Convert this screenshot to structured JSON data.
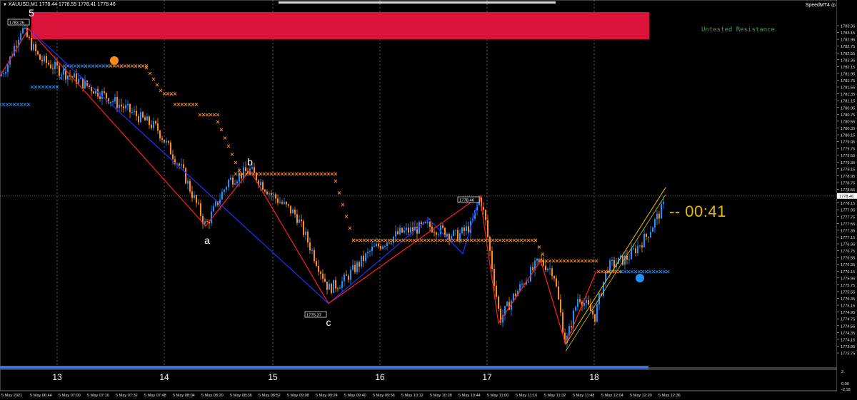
{
  "window": {
    "symbol_info": "XAUUSD,M1  1778.44 1778.55 1778.41 1778.46",
    "speed_badge": "SpeedMT4"
  },
  "labels": {
    "zone_text": "Untested Resistance",
    "countdown": "-- 00:41",
    "wave_5": "5",
    "wave_a": "a",
    "wave_b": "b",
    "wave_c": "c",
    "price_box_high": "1783.26",
    "price_box_mid": "1778.46",
    "price_box_low": "1775.37",
    "current_price_tag": "1778.46"
  },
  "colors": {
    "background": "#000000",
    "bull_candle": "#1e90ff",
    "bear_candle": "#ff8c1a",
    "resistance_zone": "#dc143c",
    "orange_marker": "#ff8c1a",
    "blue_marker": "#1e90ff",
    "zigzag": "#ff2020",
    "wave_line": "#2030ff",
    "channel": "#e6c200",
    "zone_text": "#2aa84a",
    "countdown": "#e6b800"
  },
  "axes": {
    "price_ticks": [
      "1783.35",
      "1783.15",
      "1782.95",
      "1782.75",
      "1782.55",
      "1782.35",
      "1782.15",
      "1781.95",
      "1781.75",
      "1781.55",
      "1781.35",
      "1781.15",
      "1780.95",
      "1780.75",
      "1780.55",
      "1780.35",
      "1780.15",
      "1779.95",
      "1779.75",
      "1779.55",
      "1779.35",
      "1779.15",
      "1778.95",
      "1778.75",
      "1778.55",
      "1778.35",
      "1778.15",
      "1777.95",
      "1777.75",
      "1777.55",
      "1777.35",
      "1777.15",
      "1776.95",
      "1776.75",
      "1776.55",
      "1776.35",
      "1776.15",
      "1775.95",
      "1775.75",
      "1775.55",
      "1775.35",
      "1775.15",
      "1774.95",
      "1774.75",
      "1774.55",
      "1774.35",
      "1774.15",
      "1773.95",
      "1773.75"
    ],
    "sub_ticks": [
      "2",
      "0,00",
      "-2,18"
    ],
    "time_ticks": [
      "5 May 2021",
      "5 May 06:44",
      "5 May 07:00",
      "5 May 07:16",
      "5 May 07:32",
      "5 May 07:48",
      "5 May 08:04",
      "5 May 08:20",
      "5 May 08:36",
      "5 May 08:52",
      "5 May 09:08",
      "5 May 09:24",
      "5 May 09:40",
      "5 May 09:56",
      "5 May 10:12",
      "5 May 10:28",
      "5 May 10:44",
      "5 May 11:00",
      "5 May 11:16",
      "5 May 11:32",
      "5 May 11:48",
      "5 May 12:04",
      "5 May 12:20",
      "5 May 12:36"
    ],
    "hour_labels": [
      "13",
      "14",
      "15",
      "16",
      "17",
      "18"
    ]
  },
  "chart_data": {
    "type": "candlestick",
    "symbol": "XAUUSD",
    "timeframe": "M1",
    "ylim": [
      1773.75,
      1783.45
    ],
    "waypoints": [
      [
        0,
        1781.9
      ],
      [
        12,
        1782.3
      ],
      [
        30,
        1783.3
      ],
      [
        55,
        1782.4
      ],
      [
        90,
        1782.0
      ],
      [
        150,
        1781.3
      ],
      [
        220,
        1780.4
      ],
      [
        255,
        1779.2
      ],
      [
        288,
        1777.6
      ],
      [
        320,
        1778.9
      ],
      [
        350,
        1779.2
      ],
      [
        380,
        1778.5
      ],
      [
        415,
        1777.9
      ],
      [
        460,
        1775.8
      ],
      [
        480,
        1776.0
      ],
      [
        520,
        1776.9
      ],
      [
        560,
        1777.4
      ],
      [
        600,
        1777.6
      ],
      [
        640,
        1777.3
      ],
      [
        660,
        1777.6
      ],
      [
        672,
        1778.46
      ],
      [
        680,
        1777.7
      ],
      [
        700,
        1774.9
      ],
      [
        720,
        1775.6
      ],
      [
        755,
        1776.6
      ],
      [
        775,
        1776.3
      ],
      [
        792,
        1774.2
      ],
      [
        810,
        1775.6
      ],
      [
        833,
        1775.0
      ],
      [
        850,
        1776.4
      ],
      [
        880,
        1776.7
      ],
      [
        905,
        1777.3
      ],
      [
        930,
        1778.2
      ]
    ],
    "zigzag": [
      [
        0,
        1781.9
      ],
      [
        40,
        1783.26
      ],
      [
        288,
        1777.6
      ],
      [
        350,
        1779.2
      ],
      [
        460,
        1775.37
      ],
      [
        672,
        1778.46
      ],
      [
        698,
        1774.8
      ],
      [
        757,
        1776.6
      ],
      [
        792,
        1774.2
      ],
      [
        835,
        1776.3
      ]
    ],
    "wave_blue": [
      [
        0,
        1781.9
      ],
      [
        40,
        1783.26
      ],
      [
        460,
        1775.37
      ],
      [
        600,
        1777.8
      ],
      [
        648,
        1776.8
      ],
      [
        672,
        1778.46
      ]
    ],
    "channel": [
      [
        792,
        1774.2
      ],
      [
        932,
        1778.7
      ]
    ],
    "resistance_zone": [
      1782.7,
      1783.45
    ],
    "orange_steps": [
      [
        150,
        205,
        1782.2
      ],
      [
        230,
        245,
        1781.4
      ],
      [
        245,
        275,
        1781.1
      ],
      [
        280,
        305,
        1780.8
      ],
      [
        330,
        470,
        1779.1
      ],
      [
        495,
        750,
        1777.2
      ],
      [
        755,
        835,
        1776.6
      ],
      [
        838,
        870,
        1776.3
      ]
    ],
    "orange_dots_diag": [
      [
        205,
        225,
        1782.15,
        1781.5
      ],
      [
        305,
        335,
        1780.6,
        1779.2
      ],
      [
        470,
        495,
        1778.9,
        1777.2
      ],
      [
        750,
        760,
        1777.2,
        1776.8
      ]
    ],
    "blue_steps": [
      [
        0,
        42,
        1781.1
      ],
      [
        45,
        80,
        1781.6
      ],
      [
        90,
        150,
        1782.2
      ],
      [
        870,
        935,
        1776.3
      ]
    ],
    "blue_diag": [
      [
        80,
        92,
        1781.6,
        1782.2
      ]
    ],
    "orange_dot": [
      160,
      1782.35
    ],
    "blue_dot": [
      896,
      1776.1
    ],
    "hour_x": [
      80,
      230,
      382,
      532,
      682,
      832
    ]
  }
}
